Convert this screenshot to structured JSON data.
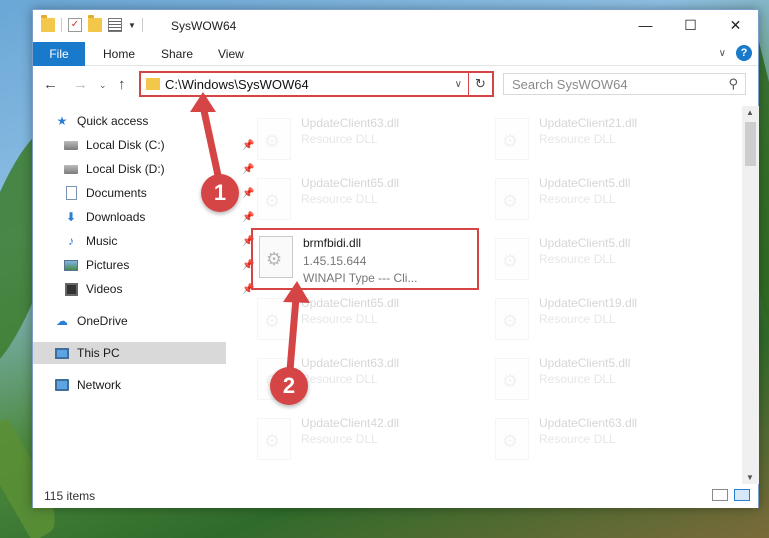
{
  "window": {
    "title": "SysWOW64",
    "controls": {
      "minimize": "—",
      "maximize": "☐",
      "close": "✕"
    }
  },
  "ribbon": {
    "file": "File",
    "tabs": [
      "Home",
      "Share",
      "View"
    ],
    "help": "?"
  },
  "navigation": {
    "back": "←",
    "forward": "→",
    "recent": "⌄",
    "up": "↑",
    "address": "C:\\Windows\\SysWOW64",
    "search_placeholder": "Search SysWOW64"
  },
  "sidebar": {
    "items": [
      {
        "label": "Quick access",
        "icon": "star-icon"
      },
      {
        "label": "Local Disk (C:)",
        "icon": "disk-icon"
      },
      {
        "label": "Local Disk (D:)",
        "icon": "disk-icon"
      },
      {
        "label": "Documents",
        "icon": "documents-icon"
      },
      {
        "label": "Downloads",
        "icon": "downloads-icon"
      },
      {
        "label": "Music",
        "icon": "music-icon"
      },
      {
        "label": "Pictures",
        "icon": "pictures-icon"
      },
      {
        "label": "Videos",
        "icon": "videos-icon"
      },
      {
        "label": "OneDrive",
        "icon": "cloud-icon"
      },
      {
        "label": "This PC",
        "icon": "computer-icon",
        "selected": true
      },
      {
        "label": "Network",
        "icon": "network-icon"
      }
    ]
  },
  "files": {
    "left": [
      {
        "name": "UpdateClient63.dll",
        "type": "Resource DLL"
      },
      {
        "name": "UpdateClient65.dll",
        "type": "Resource DLL"
      },
      {
        "name": "UpdateClient65.dll",
        "type": "Resource DLL"
      },
      {
        "name": "UpdateClient63.dll",
        "type": "Resource DLL"
      },
      {
        "name": "UpdateClient42.dll",
        "type": "Resource DLL"
      }
    ],
    "right": [
      {
        "name": "UpdateClient21.dll",
        "type": "Resource DLL"
      },
      {
        "name": "UpdateClient5.dll",
        "type": "Resource DLL"
      },
      {
        "name": "UpdateClient5.dll",
        "type": "Resource DLL"
      },
      {
        "name": "UpdateClient19.dll",
        "type": "Resource DLL"
      },
      {
        "name": "UpdateClient5.dll",
        "type": "Resource DLL"
      },
      {
        "name": "UpdateClient63.dll",
        "type": "Resource DLL"
      }
    ],
    "highlighted": {
      "name": "brmfbidi.dll",
      "version": "1.45.15.644",
      "type": "WINAPI Type --- Cli..."
    }
  },
  "status": {
    "item_count": "115 items"
  },
  "annotations": {
    "step1": "1",
    "step2": "2",
    "color": "#d64545"
  },
  "colors": {
    "accent": "#1979ca",
    "highlight": "#d64545"
  }
}
